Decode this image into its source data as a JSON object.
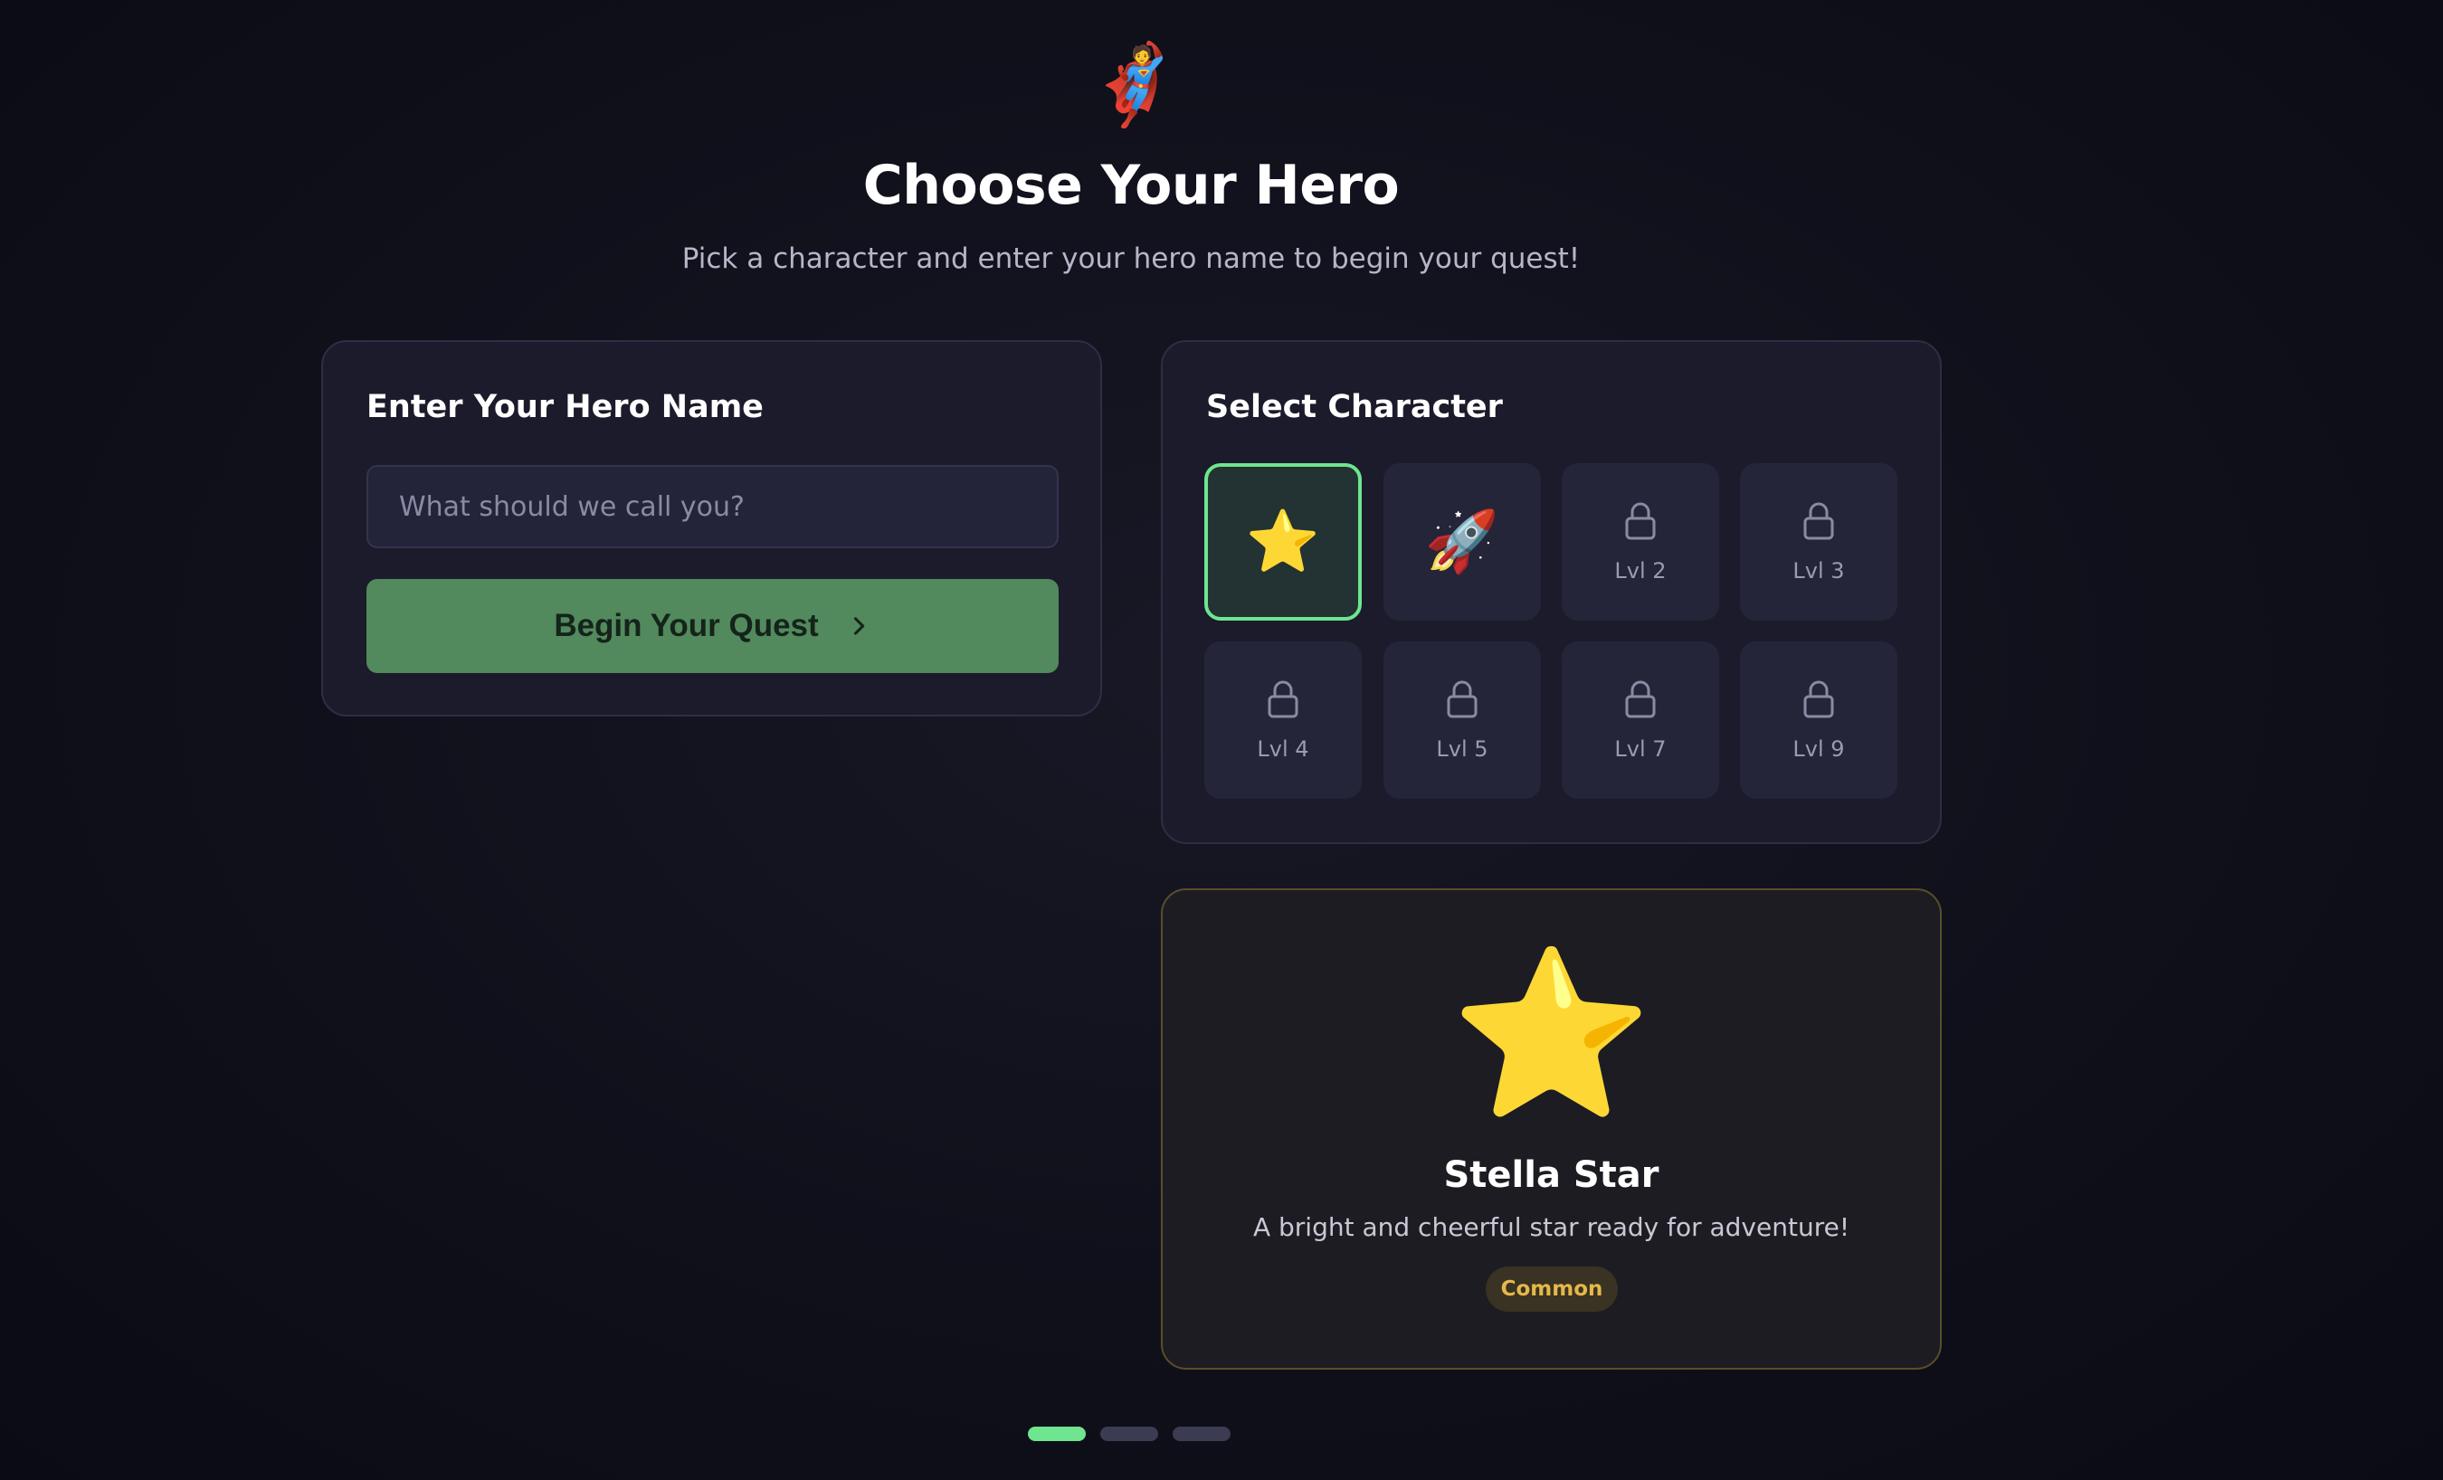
{
  "header": {
    "hero_icon": "🦸",
    "title": "Choose Your Hero",
    "subtitle": "Pick a character and enter your hero name to begin your quest!"
  },
  "name_form": {
    "title": "Enter Your Hero Name",
    "input_value": "",
    "input_placeholder": "What should we call you?",
    "button_label": "Begin Your Quest",
    "button_icon": "chevron-right-icon"
  },
  "character_select": {
    "title": "Select Character",
    "characters": [
      {
        "emoji": "⭐",
        "locked": false,
        "selected": true
      },
      {
        "emoji": "🚀",
        "locked": false,
        "selected": false
      },
      {
        "label": "Lvl 2",
        "locked": true,
        "icon": "lock-icon"
      },
      {
        "label": "Lvl 3",
        "locked": true,
        "icon": "lock-icon"
      },
      {
        "label": "Lvl 4",
        "locked": true,
        "icon": "lock-icon"
      },
      {
        "label": "Lvl 5",
        "locked": true,
        "icon": "lock-icon"
      },
      {
        "label": "Lvl 7",
        "locked": true,
        "icon": "lock-icon"
      },
      {
        "label": "Lvl 9",
        "locked": true,
        "icon": "lock-icon"
      }
    ]
  },
  "selected_character": {
    "emoji": "⭐",
    "name": "Stella Star",
    "description": "A bright and cheerful star ready for adventure!",
    "rarity": "Common"
  },
  "progress": {
    "steps": 3,
    "current": 1
  },
  "colors": {
    "accent_green": "#6ee58e",
    "button_green": "#52895d",
    "rarity_gold": "#e4b84a",
    "card_bg": "#1b1b2b"
  }
}
